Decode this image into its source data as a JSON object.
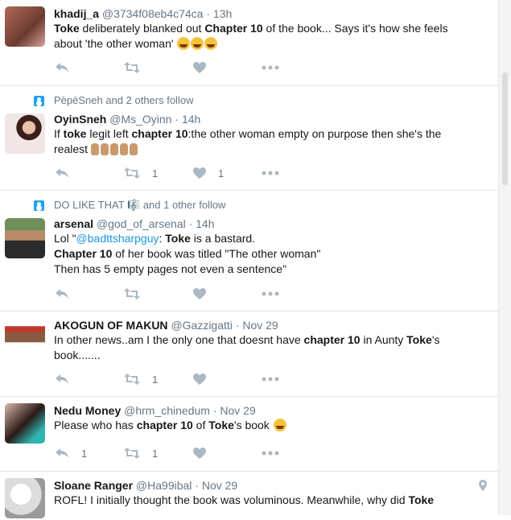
{
  "tweets": [
    {
      "name": "khadij_a",
      "handle": "@3734f08eb4c74ca",
      "time": "13h",
      "lines": [
        [
          {
            "t": "Toke",
            "b": true
          },
          {
            "t": " deliberately blanked out "
          },
          {
            "t": "Chapter 10",
            "b": true
          },
          {
            "t": " of the book... Says it's how she feels"
          }
        ],
        [
          {
            "t": "about 'the other woman' "
          },
          {
            "emoji": "laugh"
          },
          {
            "emoji": "laugh"
          },
          {
            "emoji": "laugh"
          }
        ]
      ],
      "reply_count": "",
      "retweet_count": "",
      "like_count": ""
    },
    {
      "social": "PèpèSneh and 2 others follow",
      "name": "OyinSneh",
      "handle": "@Ms_Oyinn",
      "time": "14h",
      "lines": [
        [
          {
            "t": "If "
          },
          {
            "t": "toke",
            "b": true
          },
          {
            "t": " legit left "
          },
          {
            "t": "chapter 10",
            "b": true
          },
          {
            "t": ":the other woman empty on purpose then she's the"
          }
        ],
        [
          {
            "t": "realest "
          },
          {
            "emoji": "hands"
          }
        ]
      ],
      "reply_count": "",
      "retweet_count": "1",
      "like_count": "1"
    },
    {
      "social": "DO LIKE THAT 🎼 and 1 other follow",
      "name": "arsenal",
      "handle": "@god_of_arsenal",
      "time": "14h",
      "lines": [
        [
          {
            "t": "Lol \""
          },
          {
            "t": "@badttsharpguy",
            "m": true
          },
          {
            "t": ": "
          },
          {
            "t": "Toke",
            "b": true
          },
          {
            "t": " is a bastard."
          }
        ],
        [
          {
            "t": "Chapter 10",
            "b": true
          },
          {
            "t": " of her book was titled \"The other woman\""
          }
        ],
        [
          {
            "t": "Then has 5 empty pages not even a sentence\""
          }
        ]
      ],
      "reply_count": "",
      "retweet_count": "",
      "like_count": ""
    },
    {
      "name": "AKOGUN OF MAKUN",
      "handle": "@Gazzigatti",
      "time": "Nov 29",
      "lines": [
        [
          {
            "t": "In other news..am I the only one that doesnt have "
          },
          {
            "t": "chapter 10",
            "b": true
          },
          {
            "t": " in Aunty "
          },
          {
            "t": "Toke",
            "b": true
          },
          {
            "t": "'s"
          }
        ],
        [
          {
            "t": "book......."
          }
        ]
      ],
      "reply_count": "",
      "retweet_count": "1",
      "like_count": ""
    },
    {
      "name": "Nedu Money",
      "handle": "@hrm_chinedum",
      "time": "Nov 29",
      "lines": [
        [
          {
            "t": "Please who has "
          },
          {
            "t": "chapter 10",
            "b": true
          },
          {
            "t": " of "
          },
          {
            "t": "Toke",
            "b": true
          },
          {
            "t": "'s book "
          },
          {
            "emoji": "weary"
          }
        ]
      ],
      "reply_count": "1",
      "retweet_count": "1",
      "like_count": ""
    },
    {
      "name": "Sloane Ranger",
      "handle": "@Ha99ibal",
      "time": "Nov 29",
      "lines": [
        [
          {
            "t": "ROFL! I initially thought the book was voluminous. Meanwhile, why did "
          },
          {
            "t": "Toke",
            "b": true
          }
        ]
      ],
      "reply_count": "",
      "retweet_count": "",
      "like_count": ""
    }
  ],
  "colors": {
    "link": "#1b95e0",
    "muted": "#657786",
    "action": "#aab8c2",
    "follow_icon": "#1da1f2"
  }
}
